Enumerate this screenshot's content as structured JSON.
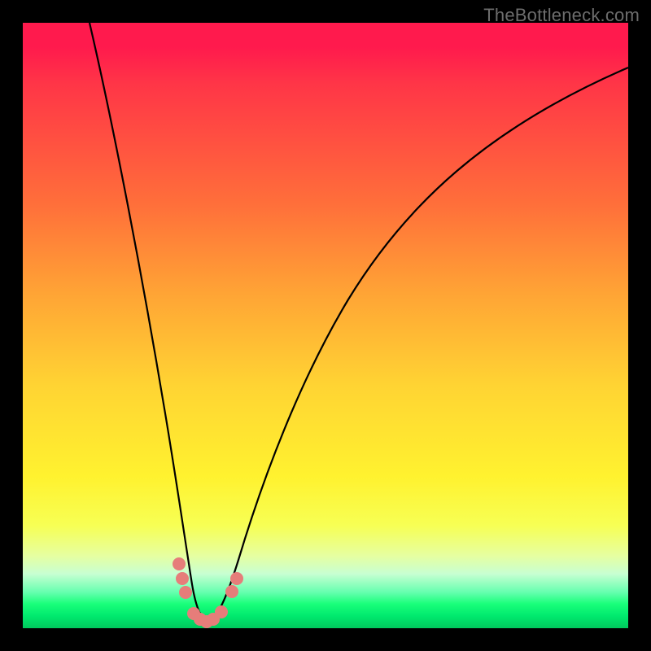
{
  "watermark": "TheBottleneck.com",
  "chart_data": {
    "type": "line",
    "title": "",
    "xlabel": "",
    "ylabel": "",
    "xlim": [
      0,
      100
    ],
    "ylim": [
      0,
      100
    ],
    "series": [
      {
        "name": "bottleneck-curve",
        "x": [
          11,
          13,
          15,
          17,
          19,
          21,
          23,
          25,
          26.5,
          28,
          29.5,
          31,
          33,
          35,
          38,
          42,
          47,
          53,
          60,
          68,
          77,
          88,
          100
        ],
        "y": [
          100,
          88,
          76,
          64,
          52,
          40,
          28,
          16,
          8,
          3,
          1,
          1,
          3,
          7,
          14,
          24,
          35,
          46,
          56,
          64,
          71,
          77,
          82
        ]
      }
    ],
    "markers": {
      "name": "highlight-dots",
      "color": "#e67d7a",
      "points": [
        {
          "x": 25.8,
          "y": 10.5
        },
        {
          "x": 26.4,
          "y": 8.0
        },
        {
          "x": 27.0,
          "y": 5.7
        },
        {
          "x": 28.2,
          "y": 2.3
        },
        {
          "x": 29.2,
          "y": 1.3
        },
        {
          "x": 30.3,
          "y": 1.0
        },
        {
          "x": 31.5,
          "y": 1.3
        },
        {
          "x": 32.8,
          "y": 2.5
        },
        {
          "x": 34.5,
          "y": 5.8
        },
        {
          "x": 35.3,
          "y": 8.0
        }
      ]
    },
    "background_gradient": {
      "top": "#ff1a4d",
      "mid": "#fff22f",
      "bottom": "#00c95d"
    }
  }
}
